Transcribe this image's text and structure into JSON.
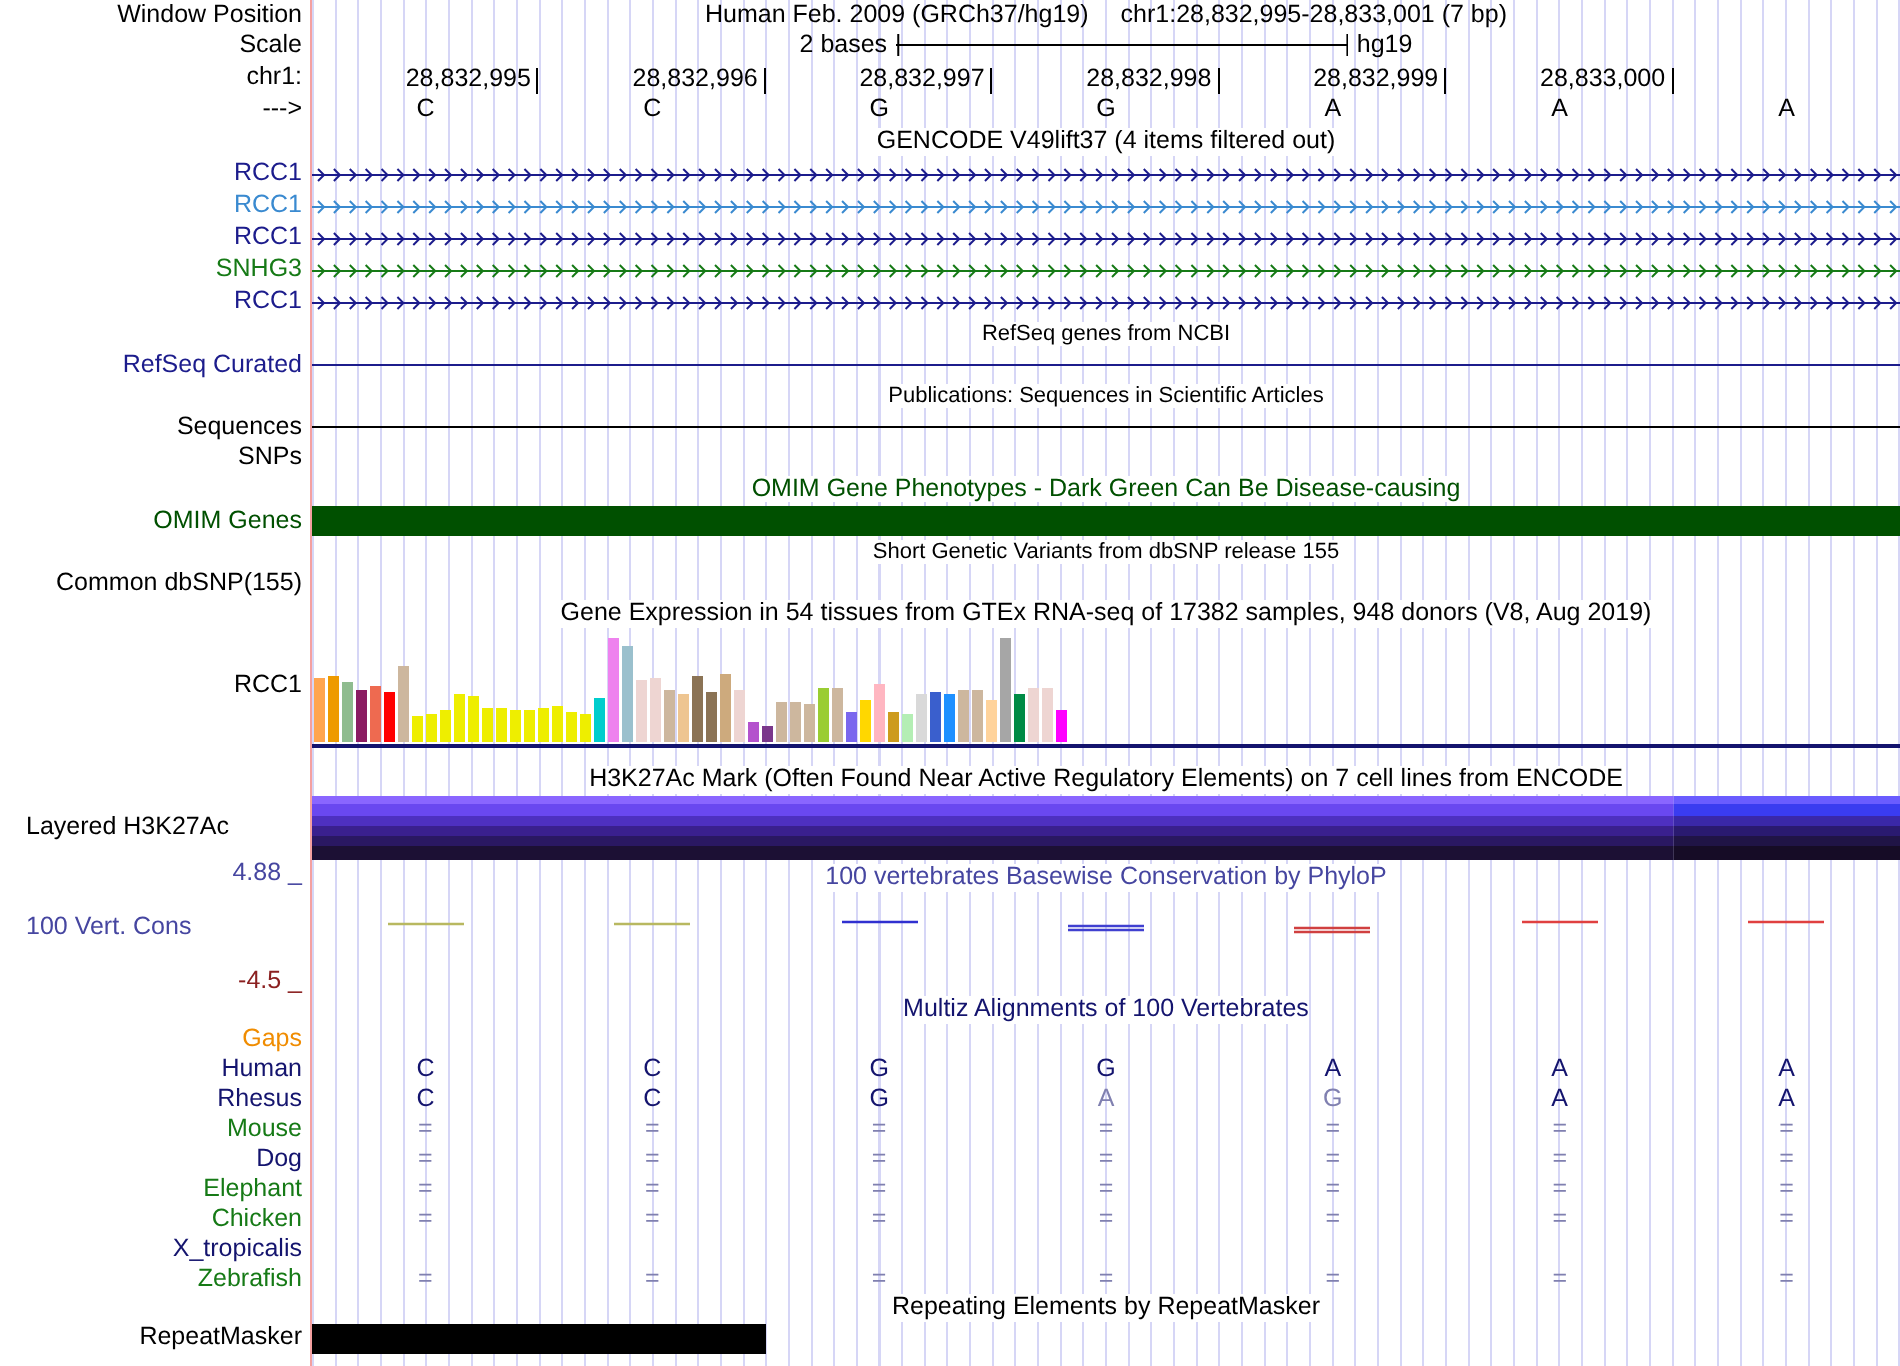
{
  "window_position": {
    "label": "Window Position",
    "assembly": "Human Feb. 2009 (GRCh37/hg19)",
    "range": "chr1:28,832,995-28,833,001 (7 bp)"
  },
  "scale": {
    "label": "Scale",
    "span": "2 bases",
    "assembly": "hg19"
  },
  "ruler": {
    "label": "chr1:",
    "positions": [
      "28,832,995",
      "28,832,996",
      "28,832,997",
      "28,832,998",
      "28,832,999",
      "28,833,000"
    ]
  },
  "strand": {
    "label": "--->",
    "bases": [
      "C",
      "C",
      "G",
      "G",
      "A",
      "A",
      "A"
    ]
  },
  "tracks": [
    {
      "kind": "genes",
      "title": "GENCODE V49lift37 (4 items filtered out)",
      "items": [
        {
          "label": "RCC1",
          "color": "#1c1c8c"
        },
        {
          "label": "RCC1",
          "color": "#3a8ad0"
        },
        {
          "label": "RCC1",
          "color": "#1c1c8c"
        },
        {
          "label": "SNHG3",
          "color": "#167a16"
        },
        {
          "label": "RCC1",
          "color": "#1c1c8c"
        }
      ]
    },
    {
      "kind": "line",
      "title": "RefSeq genes from NCBI",
      "label": "RefSeq Curated",
      "color": "#1c1c8c"
    },
    {
      "kind": "line",
      "title": "Publications: Sequences in Scientific Articles",
      "label": "Sequences",
      "color": "#000000"
    },
    {
      "kind": "blank",
      "label": "SNPs",
      "color": "#000000"
    },
    {
      "kind": "bar",
      "title": "OMIM Gene Phenotypes - Dark Green Can Be Disease-causing",
      "label": "OMIM Genes",
      "color": "#005000"
    },
    {
      "kind": "blank",
      "title": "Short Genetic Variants from dbSNP release 155",
      "label": "Common dbSNP(155)",
      "color": "#000000"
    },
    {
      "kind": "expression",
      "title": "Gene Expression in 54 tissues from GTEx RNA-seq of 17382 samples, 948 donors (V8, Aug 2019)",
      "label": "RCC1",
      "color": "#000000"
    },
    {
      "kind": "layered",
      "title": "H3K27Ac Mark (Often Found Near Active Regulatory Elements) on 7 cell lines from ENCODE",
      "label": "Layered H3K27Ac",
      "color": "#000000"
    },
    {
      "kind": "wiggle",
      "title": "100 vertebrates Basewise Conservation by PhyloP",
      "label": "100 Vert. Cons",
      "max": "4.88 _",
      "min": "-4.5 _",
      "color": "#4646a0"
    },
    {
      "kind": "alignment",
      "title": "Multiz Alignments of 100 Vertebrates",
      "species": [
        {
          "name": "Gaps",
          "color": "#f08c00"
        },
        {
          "name": "Human",
          "kind": "letters",
          "color": "#14146e",
          "bases": [
            {
              "base": "C",
              "match": true
            },
            {
              "base": "C",
              "match": true
            },
            {
              "base": "G",
              "match": true
            },
            {
              "base": "G",
              "match": true
            },
            {
              "base": "A",
              "match": true
            },
            {
              "base": "A",
              "match": true
            },
            {
              "base": "A",
              "match": true
            }
          ]
        },
        {
          "name": "Rhesus",
          "kind": "letters",
          "color": "#14146e",
          "bases": [
            {
              "base": "C",
              "match": true
            },
            {
              "base": "C",
              "match": true
            },
            {
              "base": "G",
              "match": true
            },
            {
              "base": "A",
              "match": false
            },
            {
              "base": "G",
              "match": false
            },
            {
              "base": "A",
              "match": true
            },
            {
              "base": "A",
              "match": true
            }
          ]
        },
        {
          "name": "Mouse",
          "kind": "summary",
          "color": "#167a16",
          "bases": [
            {
              "base": "=",
              "match": true
            },
            {
              "base": "=",
              "match": true
            },
            {
              "base": "=",
              "match": true
            },
            {
              "base": "=",
              "match": true
            },
            {
              "base": "=",
              "match": true
            },
            {
              "base": "=",
              "match": true
            },
            {
              "base": "=",
              "match": true
            }
          ]
        },
        {
          "name": "Dog",
          "kind": "summary",
          "color": "#14146e",
          "bases": [
            {
              "base": "=",
              "match": true
            },
            {
              "base": "=",
              "match": true
            },
            {
              "base": "=",
              "match": true
            },
            {
              "base": "=",
              "match": true
            },
            {
              "base": "=",
              "match": true
            },
            {
              "base": "=",
              "match": true
            },
            {
              "base": "=",
              "match": true
            }
          ]
        },
        {
          "name": "Elephant",
          "kind": "summary",
          "color": "#167a16",
          "bases": [
            {
              "base": "=",
              "match": true
            },
            {
              "base": "=",
              "match": true
            },
            {
              "base": "=",
              "match": true
            },
            {
              "base": "=",
              "match": true
            },
            {
              "base": "=",
              "match": true
            },
            {
              "base": "=",
              "match": true
            },
            {
              "base": "=",
              "match": true
            }
          ]
        },
        {
          "name": "Chicken",
          "kind": "summary",
          "color": "#167a16",
          "bases": [
            {
              "base": "=",
              "match": true
            },
            {
              "base": "=",
              "match": true
            },
            {
              "base": "=",
              "match": true
            },
            {
              "base": "=",
              "match": true
            },
            {
              "base": "=",
              "match": true
            },
            {
              "base": "=",
              "match": true
            },
            {
              "base": "=",
              "match": true
            }
          ]
        },
        {
          "name": "X_tropicalis",
          "color": "#14146e"
        },
        {
          "name": "Zebrafish",
          "kind": "summary",
          "color": "#167a16",
          "bases": [
            {
              "base": "=",
              "match": true
            },
            {
              "base": "=",
              "match": true
            },
            {
              "base": "=",
              "match": true
            },
            {
              "base": "=",
              "match": true
            },
            {
              "base": "=",
              "match": true
            },
            {
              "base": "=",
              "match": true
            },
            {
              "base": "=",
              "match": true
            }
          ]
        }
      ]
    },
    {
      "kind": "repeats",
      "title": "Repeating Elements by RepeatMasker",
      "label": "RepeatMasker",
      "color": "#000000"
    }
  ]
}
